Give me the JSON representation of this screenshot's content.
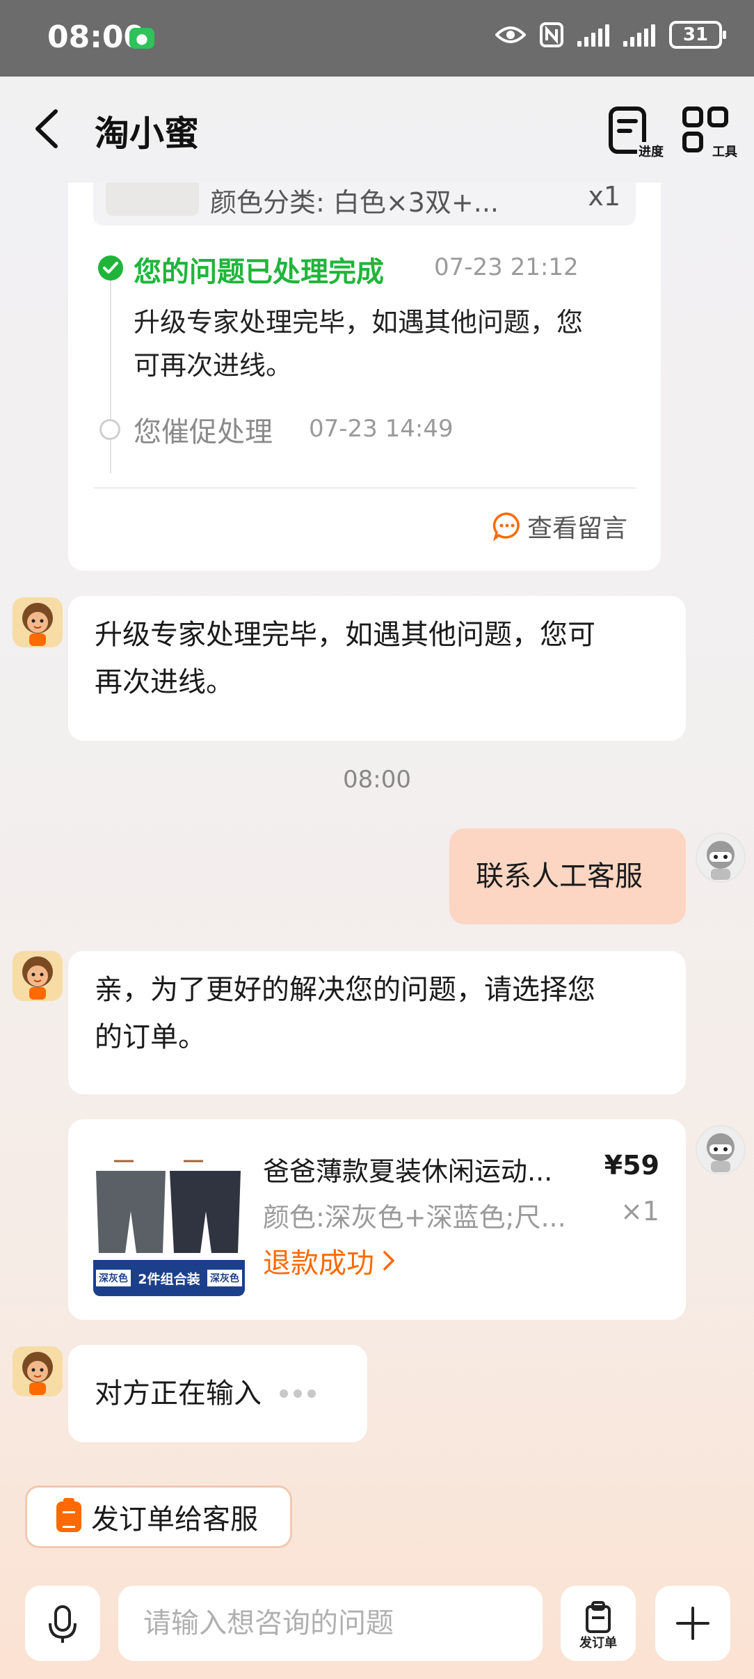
{
  "status": {
    "time": "08:00",
    "battery": "31"
  },
  "nav": {
    "title": "淘小蜜",
    "progress_label": "进度",
    "tools_label": "工具"
  },
  "top_card": {
    "product_variant": "颜色分类: 白色×3双+...",
    "product_qty": "x1",
    "step1_title": "您的问题已处理完成",
    "step1_time": "07-23 21:12",
    "step1_desc_line1": "升级专家处理完毕，如遇其他问题，您",
    "step1_desc_line2": "可再次进线。",
    "step2_title": "您催促处理",
    "step2_time": "07-23 14:49",
    "view_message_label": "查看留言"
  },
  "messages": {
    "bot1_line1": "升级专家处理完毕，如遇其他问题，您可",
    "bot1_line2": "再次进线。",
    "time_divider": "08:00",
    "user1": "联系人工客服",
    "bot2_line1": "亲，为了更好的解决您的问题，请选择您",
    "bot2_line2": "的订单。",
    "typing": "对方正在输入"
  },
  "order_card": {
    "thumb_left_tag": "深灰色",
    "thumb_center_tag": "2件组合装",
    "thumb_right_tag": "深灰色",
    "title": "爸爸薄款夏装休闲运动...",
    "price": "¥59",
    "variant": "颜色:深灰色+深蓝色;尺...",
    "qty": "×1",
    "status": "退款成功",
    "status_color": "#ff6a00"
  },
  "quick_action": {
    "label": "发订单给客服"
  },
  "input": {
    "placeholder": "请输入想咨询的问题",
    "order_button_label": "发订单"
  },
  "colors": {
    "accent": "#ff6a00",
    "success": "#1fb53a",
    "user_bubble": "#fcd6c2"
  }
}
